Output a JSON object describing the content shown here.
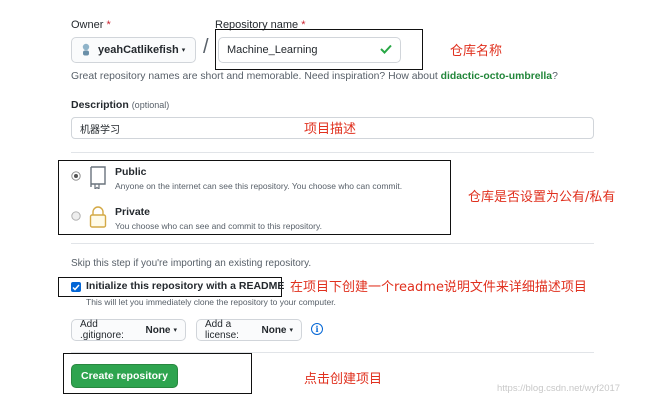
{
  "owner": {
    "label": "Owner",
    "required_mark": "*",
    "value": "yeahCatlikefish",
    "caret": "▾"
  },
  "slash": "/",
  "repo_name": {
    "label": "Repository name",
    "required_mark": "*",
    "value": "Machine_Learning"
  },
  "name_hint": {
    "prefix": "Great repository names are short and memorable. Need inspiration? How about ",
    "suggestion": "didactic-octo-umbrella",
    "suffix": "?"
  },
  "description": {
    "label": "Description",
    "optional": "(optional)",
    "value": "机器学习"
  },
  "visibility": {
    "public": {
      "title": "Public",
      "desc": "Anyone on the internet can see this repository. You choose who can commit.",
      "selected": true
    },
    "private": {
      "title": "Private",
      "desc": "You choose who can see and commit to this repository.",
      "selected": false
    }
  },
  "skip_text": "Skip this step if you're importing an existing repository.",
  "readme": {
    "label": "Initialize this repository with a README",
    "checked": true,
    "desc": "This will let you immediately clone the repository to your computer."
  },
  "gitignore_button": {
    "prefix": "Add .gitignore:",
    "value": "None"
  },
  "license_button": {
    "prefix": "Add a license:",
    "value": "None"
  },
  "info_icon": "i",
  "create_button": "Create repository",
  "annotations": {
    "repo_name": "仓库名称",
    "description": "项目描述",
    "visibility": "仓库是否设置为公有/私有",
    "readme": "在项目下创建一个readme说明文件来详细描述项目",
    "create": "点击创建项目"
  },
  "watermark": "https://blog.csdn.net/wyf2017",
  "colors": {
    "accent_green": "#2ea44f",
    "annotation_red": "#e0301e",
    "suggestion_green": "#22863a",
    "check_green": "#28a745"
  }
}
